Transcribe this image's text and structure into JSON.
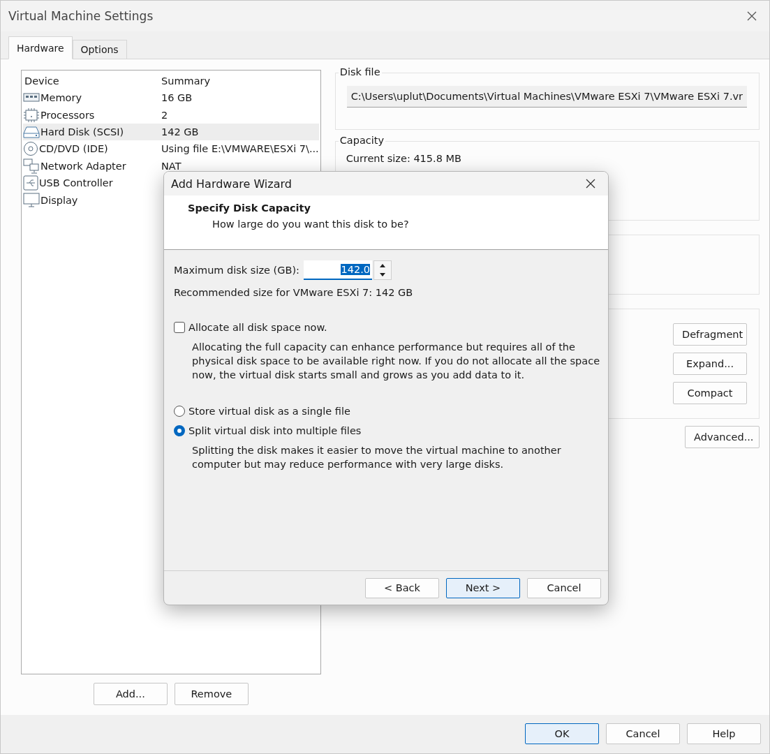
{
  "window": {
    "title": "Virtual Machine Settings"
  },
  "tabs": [
    {
      "label": "Hardware",
      "selected": true
    },
    {
      "label": "Options",
      "selected": false
    }
  ],
  "device_list": {
    "columns": [
      "Device",
      "Summary"
    ],
    "rows": [
      {
        "kind": "memory",
        "device": "Memory",
        "summary": "16 GB",
        "selected": false
      },
      {
        "kind": "processor",
        "device": "Processors",
        "summary": "2",
        "selected": false
      },
      {
        "kind": "disk",
        "device": "Hard Disk (SCSI)",
        "summary": "142 GB",
        "selected": true
      },
      {
        "kind": "cd",
        "device": "CD/DVD (IDE)",
        "summary": "Using file E:\\VMWARE\\ESXi 7\\...",
        "selected": false
      },
      {
        "kind": "network",
        "device": "Network Adapter",
        "summary": "NAT",
        "selected": false
      },
      {
        "kind": "usb",
        "device": "USB Controller",
        "selected": false
      },
      {
        "kind": "display",
        "device": "Display",
        "selected": false
      }
    ]
  },
  "list_buttons": [
    "Add...",
    "Remove"
  ],
  "disk_file": {
    "label": "Disk file",
    "value": "C:\\Users\\uplut\\Documents\\Virtual Machines\\VMware ESXi 7\\VMware ESXi 7.vr"
  },
  "capacity": {
    "label": "Capacity",
    "current_size": "Current size: 415.8 MB"
  },
  "utility_buttons": [
    "Defragment",
    "Expand...",
    "Compact"
  ],
  "advanced_button": "Advanced...",
  "footer_buttons": [
    {
      "label": "OK",
      "default": true
    },
    {
      "label": "Cancel",
      "default": false
    },
    {
      "label": "Help",
      "default": false
    }
  ],
  "wizard": {
    "title": "Add Hardware Wizard",
    "heading": "Specify Disk Capacity",
    "subheading": "How large do you want this disk to be?",
    "size_label": "Maximum disk size (GB):",
    "size_value": "142.0",
    "recommended": "Recommended size for VMware ESXi 7: 142 GB",
    "allocate": {
      "label": "Allocate all disk space now.",
      "checked": false
    },
    "allocate_note": "Allocating the full capacity can enhance performance but requires all of the physical disk space to be available right now. If you do not allocate all the space now, the virtual disk starts small and grows as you add data to it.",
    "storage_options": [
      {
        "label": "Store virtual disk as a single file",
        "selected": false
      },
      {
        "label": "Split virtual disk into multiple files",
        "selected": true
      }
    ],
    "split_note": "Splitting the disk makes it easier to move the virtual machine to another computer but may reduce performance with very large disks.",
    "buttons": [
      {
        "label": "< Back",
        "default": false
      },
      {
        "label": "Next >",
        "default": true
      },
      {
        "label": "Cancel",
        "default": false
      }
    ]
  }
}
